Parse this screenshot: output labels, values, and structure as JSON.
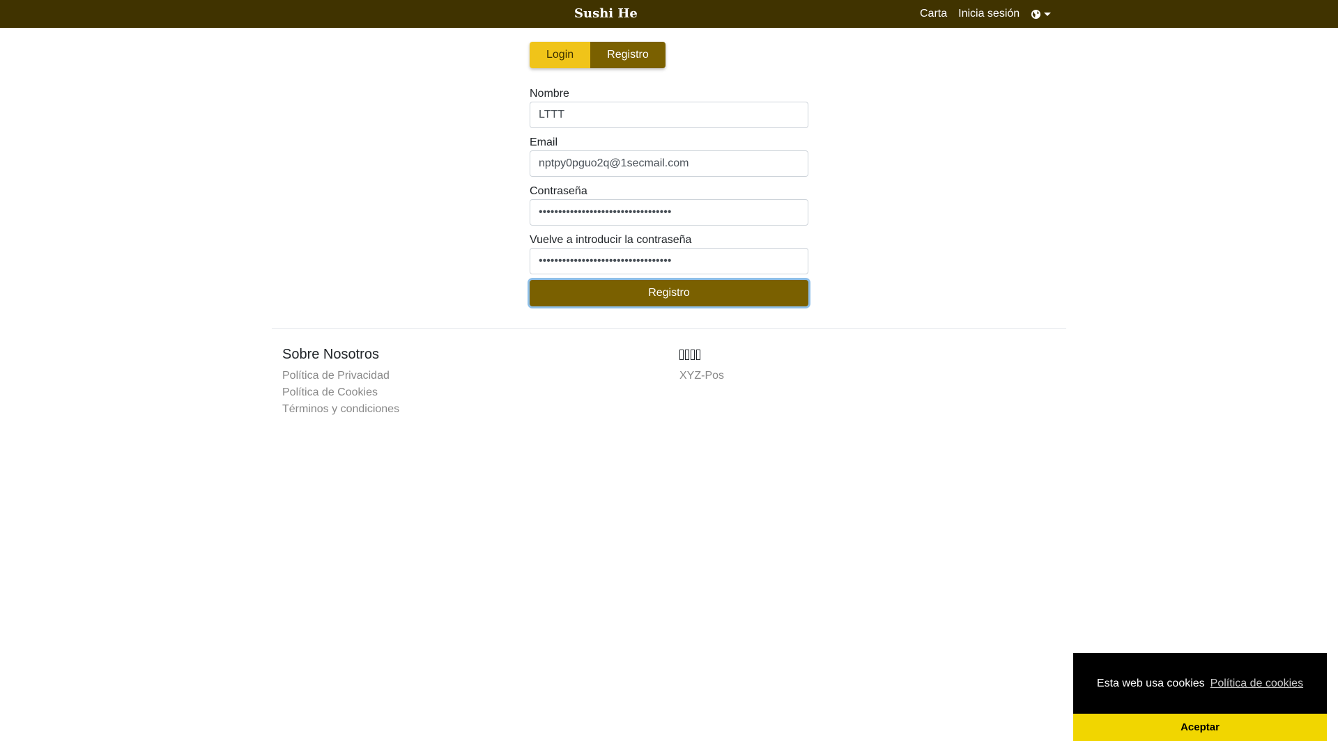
{
  "navbar": {
    "brand": "Sushi He",
    "links": [
      "Carta",
      "Inicia sesión"
    ],
    "language_icon": "globe-icon"
  },
  "tabs": {
    "login_label": "Login",
    "registro_label": "Registro",
    "active": "Registro"
  },
  "form": {
    "nombre_label": "Nombre",
    "nombre_value": "LTTT",
    "email_label": "Email",
    "email_value": "nptpy0pguo2q@1secmail.com",
    "password_label": "Contraseña",
    "password_value": "••••••••••••••••••••••••••••••••••",
    "confirm_label": "Vuelve a introducir la contraseña",
    "confirm_value": "••••••••••••••••••••••••••••••••••",
    "submit_label": "Registro"
  },
  "footer": {
    "left_heading": "Sobre Nosotros",
    "left_links": [
      "Política de Privacidad",
      "Política de Cookies",
      "Términos y condiciones"
    ],
    "right_heading_glyphs": 4,
    "right_links": [
      "XYZ-Pos"
    ]
  },
  "cookie_banner": {
    "message": "Esta web usa cookies",
    "link": "Política de cookies",
    "accept": "Aceptar"
  },
  "colors": {
    "navbar_bg": "#403300",
    "tab_login_bg": "#f0c419",
    "tab_active_bg": "#7a6000",
    "button_bg": "#7a6000",
    "cookie_accept_bg": "#f1d600"
  }
}
